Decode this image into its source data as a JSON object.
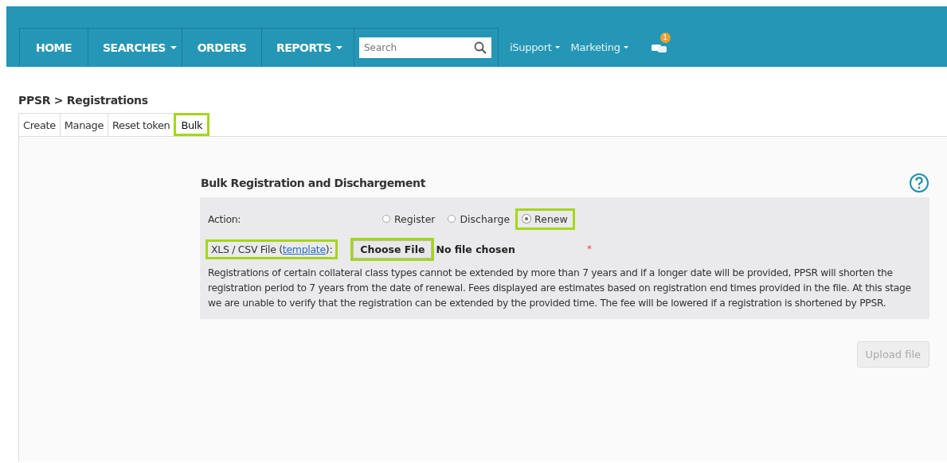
{
  "nav": {
    "items": [
      {
        "label": "HOME",
        "dropdown": false
      },
      {
        "label": "SEARCHES",
        "dropdown": true
      },
      {
        "label": "ORDERS",
        "dropdown": false
      },
      {
        "label": "REPORTS",
        "dropdown": true
      }
    ],
    "search": {
      "placeholder": "Search"
    },
    "links": [
      {
        "label": "iSupport"
      },
      {
        "label": "Marketing"
      }
    ],
    "notification_count": "1"
  },
  "breadcrumb": "PPSR > Registrations",
  "tabs": [
    {
      "label": "Create",
      "selected": false,
      "highlighted": false
    },
    {
      "label": "Manage",
      "selected": false,
      "highlighted": false
    },
    {
      "label": "Reset token",
      "selected": false,
      "highlighted": false
    },
    {
      "label": "Bulk",
      "selected": true,
      "highlighted": true
    }
  ],
  "form": {
    "title": "Bulk Registration and Dischargement",
    "action_label": "Action:",
    "actions": [
      {
        "label": "Register",
        "selected": false,
        "highlighted": false
      },
      {
        "label": "Discharge",
        "selected": false,
        "highlighted": false
      },
      {
        "label": "Renew",
        "selected": true,
        "highlighted": true
      }
    ],
    "file_label": "XLS / CSV File (",
    "file_link": "template",
    "file_label_end": "):",
    "file_label_highlighted": true,
    "choose_button": "Choose File",
    "choose_highlighted": true,
    "file_status": "No file chosen",
    "required_mark": "*",
    "note": "Registrations of certain collateral class types cannot be extended by more than 7 years and if a longer date will be provided, PPSR will shorten the registration period to 7 years from the date of renewal. Fees displayed are estimates based on registration end times provided in the file. At this stage we are unable to verify that the registration can be extended by the provided time. The fee will be lowered if a registration is shortened by PPSR.",
    "upload_button": "Upload file",
    "upload_disabled": true
  }
}
